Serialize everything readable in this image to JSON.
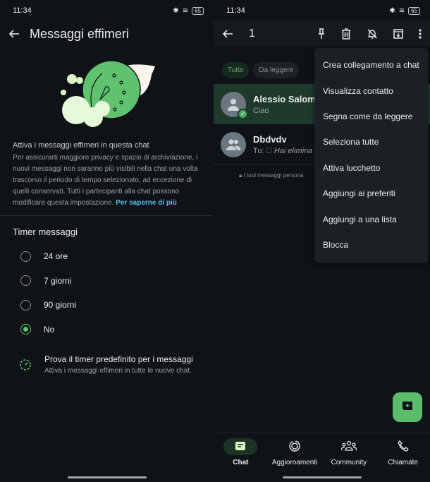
{
  "status": {
    "time": "11:34",
    "battery": "65"
  },
  "left": {
    "title": "Messaggi effimeri",
    "section_title": "Attiva i messaggi effimeri in questa chat",
    "description": "Per assicurarti maggiore privacy e spazio di archiviazione, i nuovi messaggi non saranno più visibili nella chat una volta trascorso il periodo di tempo selezionato, ad eccezione di quelli conservati. Tutti i partecipanti alla chat possono modificare questa impostazione.",
    "learn_more": "Per saperne di più",
    "timer_heading": "Timer messaggi",
    "options": [
      {
        "label": "24 ore",
        "selected": false
      },
      {
        "label": "7 giorni",
        "selected": false
      },
      {
        "label": "90 giorni",
        "selected": false
      },
      {
        "label": "No",
        "selected": true
      }
    ],
    "promo_title": "Prova il timer predefinito per i messaggi",
    "promo_subtitle": "Attiva i messaggi effimeri in tutte le nuove chat."
  },
  "right": {
    "selected_count": "1",
    "chips": [
      "Tutte",
      "Da leggere"
    ],
    "chats": [
      {
        "name": "Alessio Salome",
        "message": "Ciao",
        "selected": true
      },
      {
        "name": "Dbdvdv",
        "prefix": "Tu:",
        "message": "Hai elimina"
      }
    ],
    "encryption_note": "I tuoi messaggi persona",
    "menu": [
      "Crea collegamento a chat",
      "Visualizza contatto",
      "Segna come da leggere",
      "Seleziona tutte",
      "Attiva lucchetto",
      "Aggiungi ai preferiti",
      "Aggiungi a una lista",
      "Blocca"
    ],
    "nav": [
      "Chat",
      "Aggiornamenti",
      "Community",
      "Chiamate"
    ]
  },
  "colors": {
    "accent": "#5bbd6c",
    "link": "#53bdeb",
    "selected_row": "#1f3a2a"
  }
}
